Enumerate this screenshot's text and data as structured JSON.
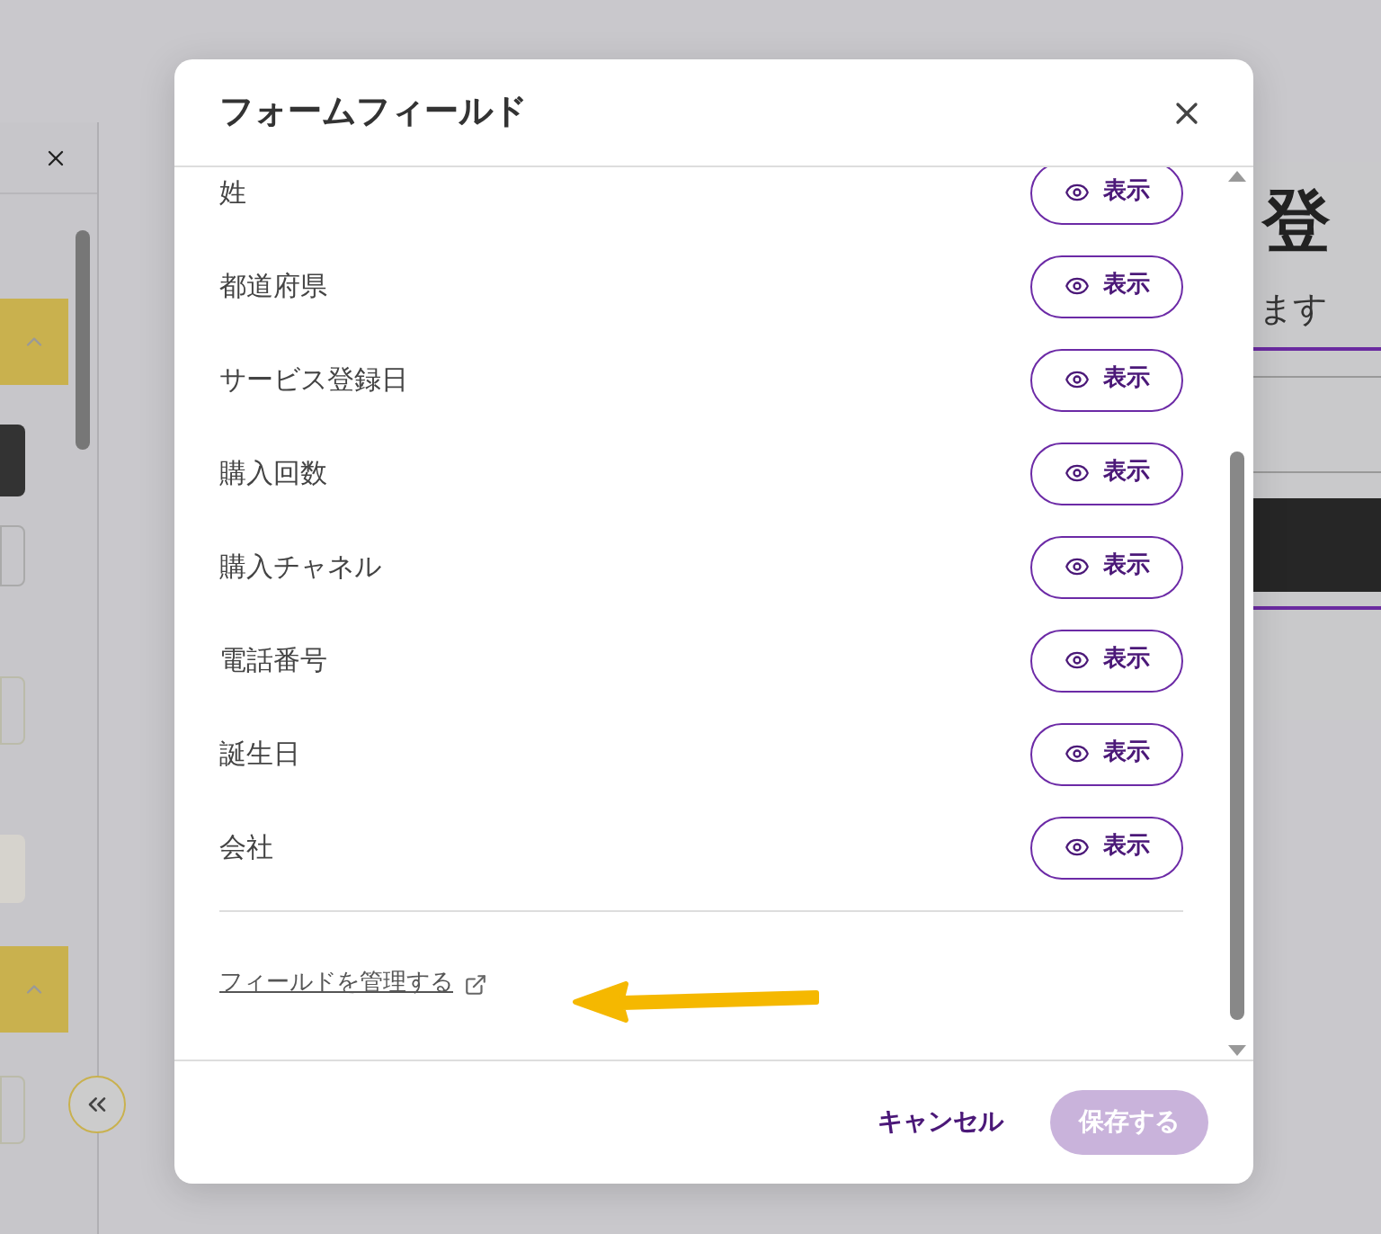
{
  "preview": {
    "heading": "登",
    "subtitle": "ます"
  },
  "dialog": {
    "title": "フォームフィールド",
    "fields": [
      {
        "name": "姓",
        "action": "表示"
      },
      {
        "name": "都道府県",
        "action": "表示"
      },
      {
        "name": "サービス登録日",
        "action": "表示"
      },
      {
        "name": "購入回数",
        "action": "表示"
      },
      {
        "name": "購入チャネル",
        "action": "表示"
      },
      {
        "name": "電話番号",
        "action": "表示"
      },
      {
        "name": "誕生日",
        "action": "表示"
      },
      {
        "name": "会社",
        "action": "表示"
      }
    ],
    "manage_link": "フィールドを管理する",
    "buttons": [
      {
        "label": "キャンセル",
        "kind": "secondary",
        "disabled": false
      },
      {
        "label": "保存する",
        "kind": "primary",
        "disabled": true
      }
    ]
  }
}
